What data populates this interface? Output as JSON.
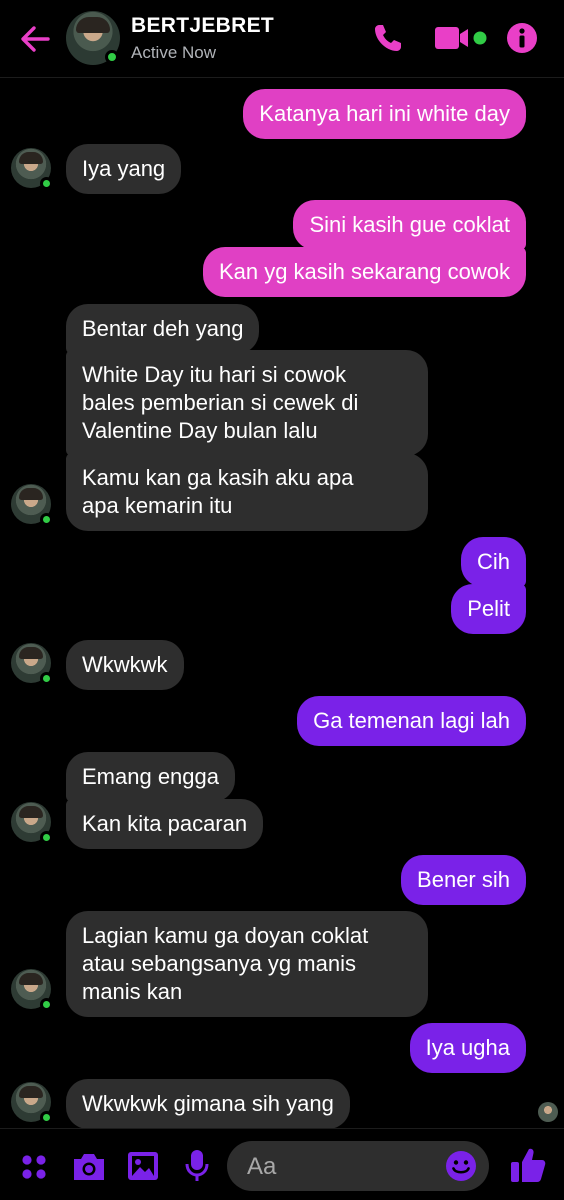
{
  "header": {
    "name": "BERTJEBRET",
    "status": "Active Now"
  },
  "colors": {
    "outgoing_early": "#e040c4",
    "outgoing_late": "#7a22e8",
    "incoming": "#2e2e2e",
    "online": "#31cc46"
  },
  "messages": [
    {
      "side": "out",
      "text": "Katanya hari ini white day"
    },
    {
      "side": "in",
      "text": "Iya yang"
    },
    {
      "side": "out",
      "text": "Sini kasih gue coklat"
    },
    {
      "side": "out",
      "text": "Kan yg kasih sekarang cowok"
    },
    {
      "side": "in",
      "text": "Bentar deh yang"
    },
    {
      "side": "in",
      "lines": [
        "White Day itu hari si cowok",
        "bales pemberian si cewek di",
        "Valentine Day bulan lalu"
      ]
    },
    {
      "side": "in",
      "lines": [
        "Kamu kan ga kasih aku apa",
        "apa kemarin itu"
      ]
    },
    {
      "side": "out",
      "text": "Cih"
    },
    {
      "side": "out",
      "text": "Pelit"
    },
    {
      "side": "in",
      "text": "Wkwkwk"
    },
    {
      "side": "out",
      "text": "Ga temenan lagi lah"
    },
    {
      "side": "in",
      "text": "Emang engga"
    },
    {
      "side": "in",
      "text": "Kan kita pacaran"
    },
    {
      "side": "out",
      "text": "Bener sih"
    },
    {
      "side": "in",
      "lines": [
        "Lagian kamu ga doyan coklat",
        "atau sebangsanya yg manis",
        "manis kan"
      ]
    },
    {
      "side": "out",
      "text": "Iya ugha"
    },
    {
      "side": "in",
      "text": "Wkwkwk gimana sih yang"
    }
  ],
  "composer": {
    "placeholder": "Aa"
  },
  "icons": {
    "back": "back-arrow-icon",
    "call": "phone-icon",
    "video": "video-camera-icon",
    "info": "info-icon",
    "more": "four-dots-icon",
    "camera": "camera-icon",
    "gallery": "image-icon",
    "mic": "microphone-icon",
    "emoji": "emoji-icon",
    "like": "thumbs-up-icon"
  }
}
